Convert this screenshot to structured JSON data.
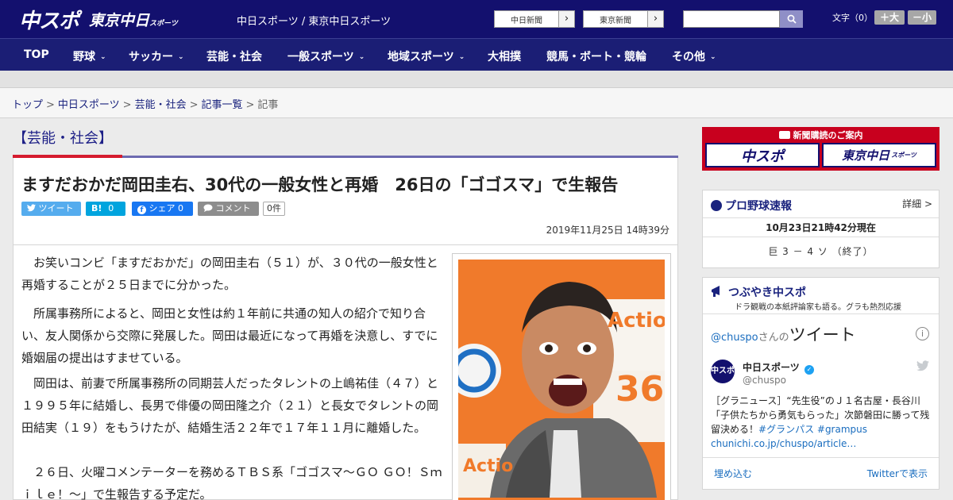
{
  "header": {
    "logo_main": "中スポ",
    "logo_sub": "東京中日",
    "logo_sub_small": "スポーツ",
    "site_name": "中日スポーツ / 東京中日スポーツ",
    "paper_links": [
      {
        "label": "中日新聞",
        "arrow": "›"
      },
      {
        "label": "東京新聞",
        "arrow": "›"
      }
    ],
    "search_placeholder": "",
    "font_size_label": "文字（0）",
    "font_larger": "＋大",
    "font_smaller": "－小"
  },
  "nav": [
    {
      "label": "TOP",
      "dropdown": false
    },
    {
      "label": "野球",
      "dropdown": true
    },
    {
      "label": "サッカー",
      "dropdown": true
    },
    {
      "label": "芸能・社会",
      "dropdown": false
    },
    {
      "label": "一般スポーツ",
      "dropdown": true
    },
    {
      "label": "地域スポーツ",
      "dropdown": true
    },
    {
      "label": "大相撲",
      "dropdown": false
    },
    {
      "label": "競馬・ボート・競輪",
      "dropdown": false
    },
    {
      "label": "その他",
      "dropdown": true
    }
  ],
  "breadcrumb": {
    "items": [
      "トップ",
      "中日スポーツ",
      "芸能・社会",
      "記事一覧"
    ],
    "current": "記事",
    "separator": ">"
  },
  "article": {
    "category": "【芸能・社会】",
    "headline": "ますだおかだ岡田圭右、30代の一般女性と再婚　26日の「ゴゴスマ」で生報告",
    "share": {
      "tweet": "ツイート",
      "hatena": "B!",
      "hatena_count": "0",
      "facebook": "シェア",
      "facebook_count": "0",
      "comment": "コメント",
      "comment_count": "0件"
    },
    "date": "2019年11月25日 14時39分",
    "paragraphs": [
      "お笑いコンビ「ますだおかだ」の岡田圭右（５１）が、３０代の一般女性と再婚することが２５日までに分かった。",
      "所属事務所によると、岡田と女性は約１年前に共通の知人の紹介で知り合い、友人関係から交際に発展した。岡田は最近になって再婚を決意し、すでに婚姻届の提出はすませている。",
      "岡田は、前妻で所属事務所の同期芸人だったタレントの上嶋祐佳（４７）と１９９５年に結婚し、長男で俳優の岡田隆之介（２１）と長女でタレントの岡田結実（１９）をもうけたが、結婚生活２２年で１７年１１月に離婚した。",
      "２６日、火曜コメンテーターを務めるＴＢＳ系「ゴゴスマ～ＧＯ ＧＯ！Ｓｍｉｌｅ！～」で生報告する予定だ。"
    ],
    "photo": {
      "backdrop_text": "Actio",
      "backdrop_number": "36",
      "backdrop_text2": "Actio"
    }
  },
  "sidebar": {
    "subscribe_title": "新聞購読のご案内",
    "subscribe_left": "中スポ",
    "subscribe_right": "東京中日",
    "subscribe_right_small": "スポーツ",
    "baseball": {
      "title": "プロ野球速報",
      "detail": "詳細 >",
      "status": "10月23日21時42分現在",
      "score": "巨 3 － 4 ソ （終了）"
    },
    "tweets": {
      "title": "つぶやき中スポ",
      "subtitle": "ドラ観戦の本紙評論家も語る。グラも熱烈応援",
      "timeline_handle": "@chuspo",
      "timeline_san": "さんの",
      "timeline_word": "ツイート",
      "info": "i",
      "avatar_text": "中スポ",
      "account_name": "中日スポーツ",
      "account_handle": "@chuspo",
      "tweet_text": "［グラニュース］“先生役”のＪ１名古屋・長谷川「子供たちから勇気もらった」次節磐田に勝って残留決める！",
      "tweet_tags": "#グランパス #grampus",
      "tweet_link": "chunichi.co.jp/chuspo/article…",
      "embed": "埋め込む",
      "view_on_twitter": "Twitterで表示"
    }
  },
  "colors": {
    "brand_navy": "#13106e",
    "accent_red": "#d51b2e",
    "twitter_blue": "#55acee",
    "facebook_blue": "#1877f2"
  }
}
